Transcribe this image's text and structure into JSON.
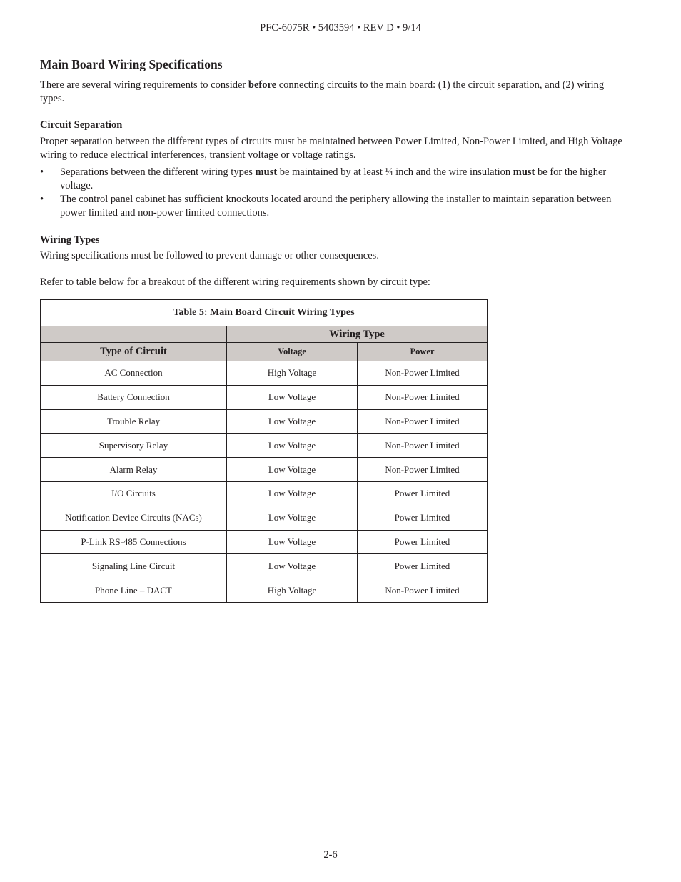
{
  "header": {
    "text": "PFC-6075R • 5403594 • REV D • 9/14"
  },
  "section": {
    "title": "Main Board Wiring Specifications",
    "intro": {
      "before": "There are several wiring requirements to consider ",
      "emphasis": "before",
      "after": " connecting circuits to the main board: (1) the circuit separation, and (2) wiring types."
    },
    "circuit_separation": {
      "heading": "Circuit Separation",
      "text": "Proper separation between the different types of circuits must be maintained between Power Limited, Non-Power Limited, and High Voltage wiring to reduce electrical interferences, transient voltage or voltage ratings.",
      "bullet_marker": "•",
      "bullets": [
        {
          "part1": "Separations between the different wiring types ",
          "em1": "must",
          "part2": " be maintained by at least ¼ inch and the wire insulation ",
          "em2": "must",
          "part3": " be for the higher voltage."
        },
        {
          "text": "The control panel cabinet has sufficient knockouts located around the periphery allowing the installer to maintain separation between power limited and non-power limited connections."
        }
      ]
    },
    "wiring_types": {
      "heading": "Wiring Types",
      "text": "Wiring specifications must be followed to prevent damage or other consequences.",
      "refer": "Refer to table below for a breakout of the different wiring requirements shown by circuit type:"
    }
  },
  "table": {
    "caption": "Table 5: Main Board Circuit Wiring Types",
    "group_header": "Wiring Type",
    "columns": [
      "Type of Circuit",
      "Voltage",
      "Power"
    ],
    "rows": [
      [
        "AC Connection",
        "High Voltage",
        "Non-Power Limited"
      ],
      [
        "Battery Connection",
        "Low Voltage",
        "Non-Power Limited"
      ],
      [
        "Trouble Relay",
        "Low Voltage",
        "Non-Power Limited"
      ],
      [
        "Supervisory Relay",
        "Low Voltage",
        "Non-Power Limited"
      ],
      [
        "Alarm Relay",
        "Low Voltage",
        "Non-Power Limited"
      ],
      [
        "I/O Circuits",
        "Low Voltage",
        "Power Limited"
      ],
      [
        "Notification Device Circuits (NACs)",
        "Low Voltage",
        "Power Limited"
      ],
      [
        "P-Link RS-485 Connections",
        "Low Voltage",
        "Power Limited"
      ],
      [
        "Signaling Line Circuit",
        "Low Voltage",
        "Power Limited"
      ],
      [
        "Phone Line – DACT",
        "High Voltage",
        "Non-Power Limited"
      ]
    ],
    "header_fill": "#cfcac7"
  },
  "footer": {
    "page_number": "2-6"
  }
}
